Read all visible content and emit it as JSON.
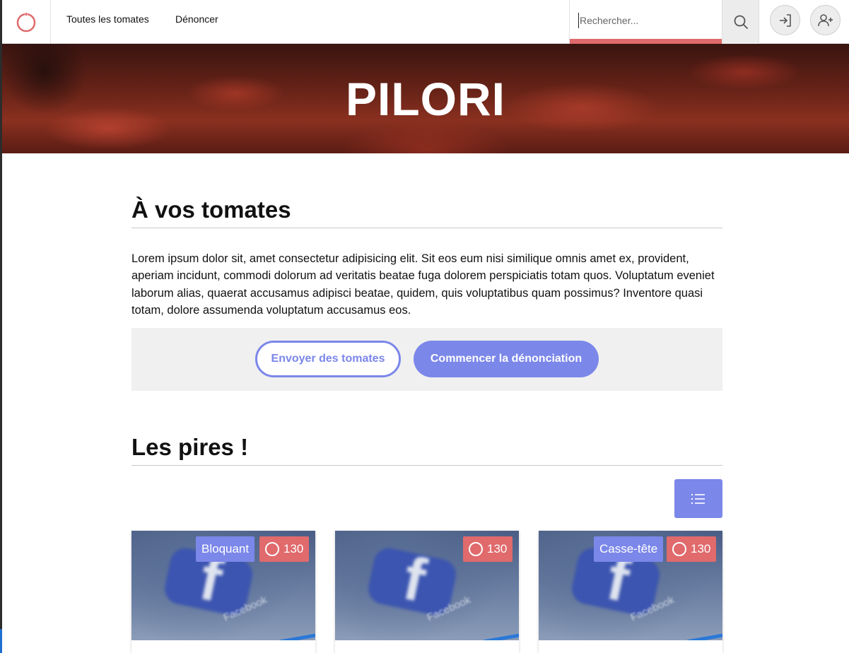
{
  "header": {
    "nav": [
      {
        "label": "Toutes les tomates"
      },
      {
        "label": "Dénoncer"
      }
    ],
    "search": {
      "placeholder": "Rechercher...",
      "value": ""
    }
  },
  "hero": {
    "title": "PILORI"
  },
  "intro": {
    "title": "À vos tomates",
    "text": "Lorem ipsum dolor sit, amet consectetur adipisicing elit. Sit eos eum nisi similique omnis amet ex, provident, aperiam incidunt, commodi dolorum ad veritatis beatae fuga dolorem perspiciatis totam quos. Voluptatum eveniet laborum alias, quaerat accusamus adipisci beatae, quidem, quis voluptatibus quam possimus? Inventore quasi totam, dolore assumenda voluptatum accusamus eos.",
    "btn_outline": "Envoyer des tomates",
    "btn_filled": "Commencer la dénonciation"
  },
  "worst": {
    "title": "Les pires !",
    "cards": [
      {
        "tag": "Bloquant",
        "count": "130",
        "image_text": "Facebook"
      },
      {
        "tag": "",
        "count": "130",
        "image_text": "Facebook"
      },
      {
        "tag": "Casse-tête",
        "count": "130",
        "image_text": "Facebook"
      }
    ]
  },
  "colors": {
    "accent": "#7b87e9",
    "danger": "#e06a6c"
  },
  "icons": {
    "logo": "power-ring-icon",
    "search": "search-icon",
    "login": "login-icon",
    "register": "add-user-icon",
    "list_view": "list-icon",
    "tomato_count": "ring-icon"
  }
}
